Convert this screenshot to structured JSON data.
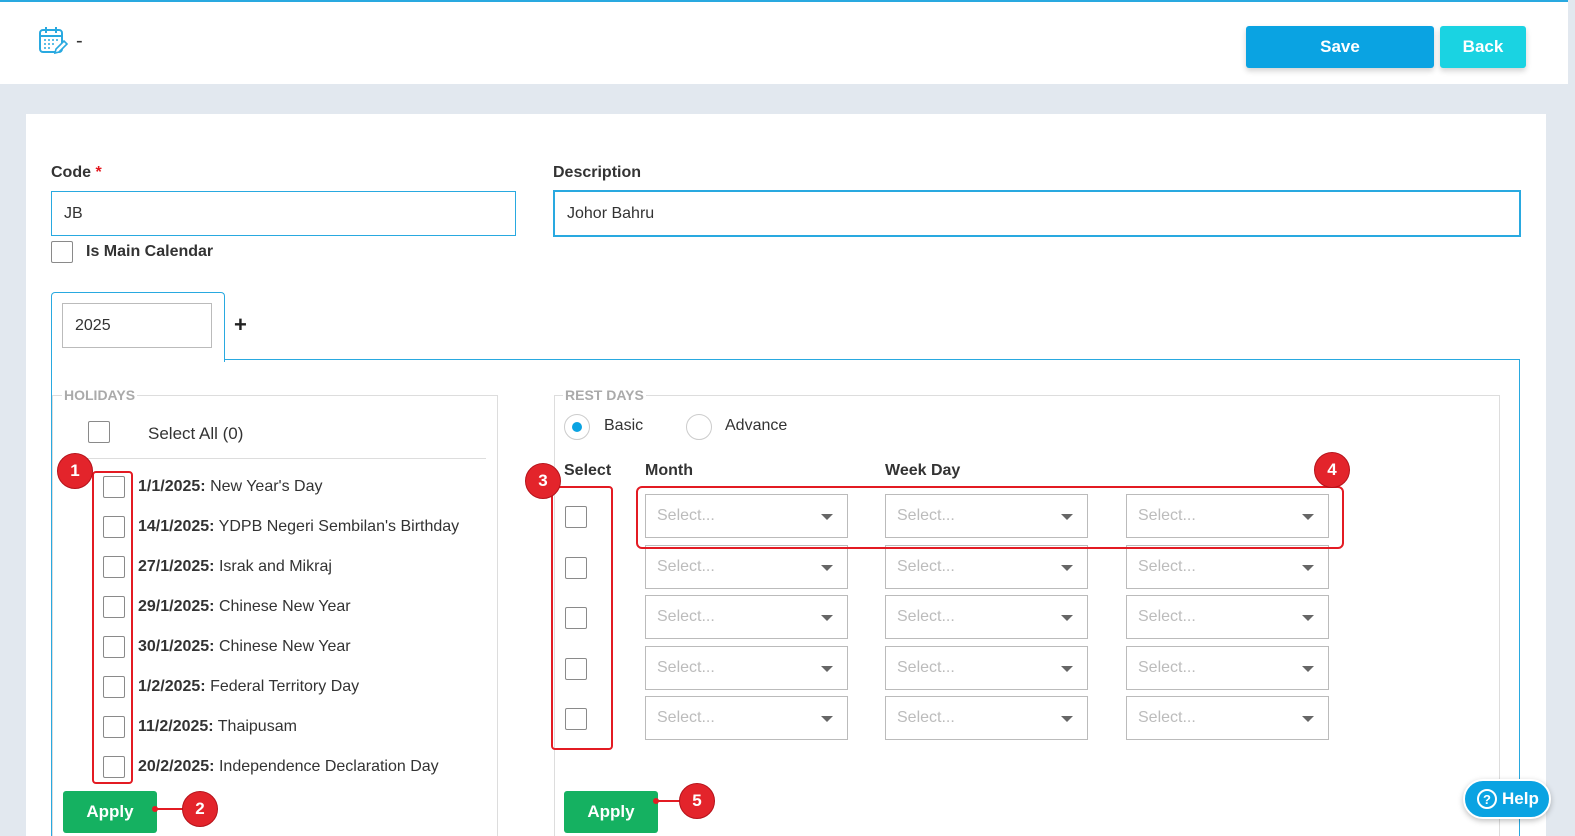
{
  "header": {
    "title": "-",
    "save_label": "Save",
    "back_label": "Back",
    "icon": "calendar-edit-icon"
  },
  "form": {
    "code_label": "Code",
    "code_required_mark": "*",
    "code_value": "JB",
    "description_label": "Description",
    "description_value": "Johor Bahru",
    "is_main_calendar_label": "Is Main Calendar"
  },
  "tabs": {
    "year_value": "2025",
    "add_label": "+"
  },
  "holidays": {
    "legend": "HOLIDAYS",
    "select_all_label": "Select All (0)",
    "items": [
      {
        "date": "1/1/2025:",
        "name": "New Year's Day"
      },
      {
        "date": "14/1/2025:",
        "name": "YDPB Negeri Sembilan's Birthday"
      },
      {
        "date": "27/1/2025:",
        "name": "Israk and Mikraj"
      },
      {
        "date": "29/1/2025:",
        "name": "Chinese New Year"
      },
      {
        "date": "30/1/2025:",
        "name": "Chinese New Year"
      },
      {
        "date": "1/2/2025:",
        "name": "Federal Territory Day"
      },
      {
        "date": "11/2/2025:",
        "name": "Thaipusam"
      },
      {
        "date": "20/2/2025:",
        "name": "Independence Declaration Day"
      }
    ],
    "apply_label": "Apply"
  },
  "rest_days": {
    "legend": "REST DAYS",
    "radio_basic_label": "Basic",
    "radio_advance_label": "Advance",
    "col_select": "Select",
    "col_month": "Month",
    "col_weekday": "Week Day",
    "select_placeholder": "Select...",
    "apply_label": "Apply"
  },
  "annotations": [
    "1",
    "2",
    "3",
    "4",
    "5"
  ],
  "help_label": "Help",
  "colors": {
    "primary": "#0aa3e2",
    "back": "#1ad3e2",
    "apply": "#15b161",
    "annotation": "#e3242b"
  }
}
